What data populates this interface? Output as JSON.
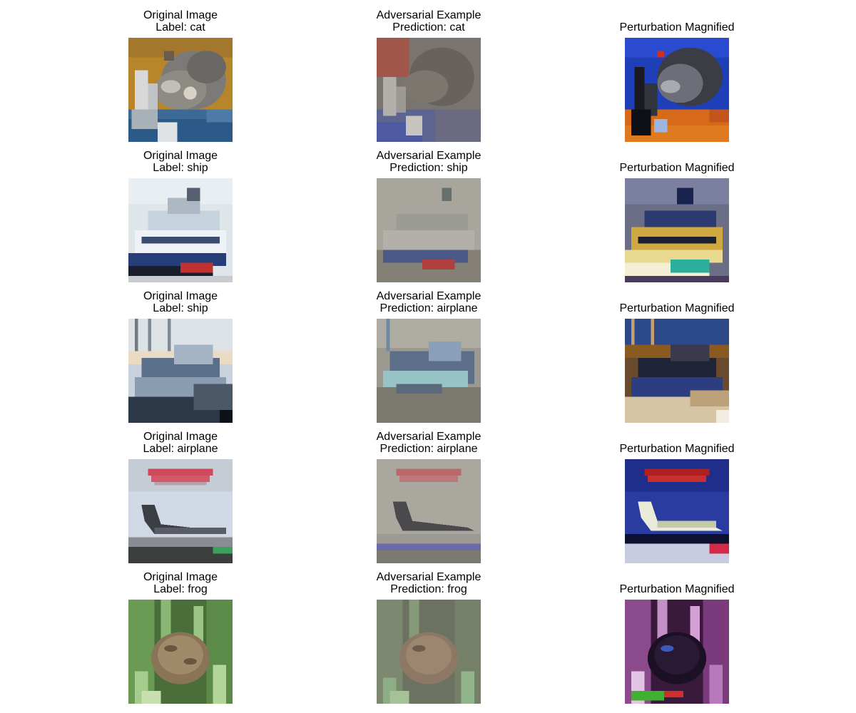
{
  "figure": {
    "rows": [
      {
        "original": {
          "title": "Original Image",
          "caption": "Label: cat",
          "depicts": "cat"
        },
        "adversarial": {
          "title": "Adversarial Example",
          "caption": "Prediction: cat",
          "depicts": "cat"
        },
        "perturbation": {
          "title": "Perturbation Magnified",
          "depicts": "cat"
        }
      },
      {
        "original": {
          "title": "Original Image",
          "caption": "Label: ship",
          "depicts": "ship"
        },
        "adversarial": {
          "title": "Adversarial Example",
          "caption": "Prediction: ship",
          "depicts": "ship"
        },
        "perturbation": {
          "title": "Perturbation Magnified",
          "depicts": "ship"
        }
      },
      {
        "original": {
          "title": "Original Image",
          "caption": "Label: ship",
          "depicts": "ship"
        },
        "adversarial": {
          "title": "Adversarial Example",
          "caption": "Prediction: airplane",
          "depicts": "ship"
        },
        "perturbation": {
          "title": "Perturbation Magnified",
          "depicts": "ship"
        }
      },
      {
        "original": {
          "title": "Original Image",
          "caption": "Label: airplane",
          "depicts": "airplane"
        },
        "adversarial": {
          "title": "Adversarial Example",
          "caption": "Prediction: airplane",
          "depicts": "airplane"
        },
        "perturbation": {
          "title": "Perturbation Magnified",
          "depicts": "airplane"
        }
      },
      {
        "original": {
          "title": "Original Image",
          "caption": "Label: frog",
          "depicts": "frog"
        },
        "adversarial": {
          "title": "Adversarial Example",
          "caption": "Prediction: frog",
          "depicts": "frog"
        },
        "perturbation": {
          "title": "Perturbation Magnified",
          "depicts": "frog"
        }
      }
    ]
  }
}
